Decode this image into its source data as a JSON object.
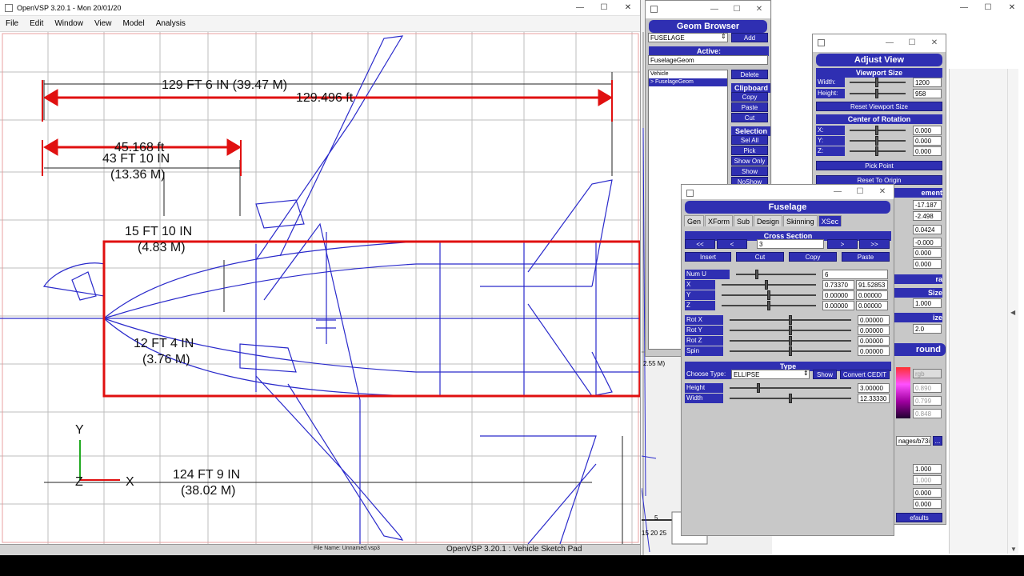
{
  "main_window": {
    "title": "OpenVSP 3.20.1 - Mon 20/01/20",
    "menu": [
      "File",
      "Edit",
      "Window",
      "View",
      "Model",
      "Analysis"
    ],
    "status_file": "File Name: Unnamed.vsp3",
    "status_title": "OpenVSP 3.20.1 : Vehicle Sketch Pad"
  },
  "drawing": {
    "dim_overall": "129 FT 6 IN (39.47 M)",
    "meas_overall": "129.496 ft",
    "meas_fwd": "45.168 ft",
    "dim_fwd_1": "43 FT 10 IN",
    "dim_fwd_2": "(13.36 M)",
    "dim_height_1": "15 FT 10 IN",
    "dim_height_2": "(4.83 M)",
    "dim_width_1": "12 FT 4 IN",
    "dim_width_2": "(3.76 M)",
    "dim_wing_1": "124 FT 9 IN",
    "dim_wing_2": "(38.02 M)",
    "axis_y": "Y",
    "axis_z": "Z",
    "axis_x": "X",
    "side_note": "2.55 M)",
    "ruler_1": "5",
    "ruler_2": "15  20  25"
  },
  "geom_browser": {
    "title": "Geom Browser",
    "type_select": "FUSELAGE",
    "add": "Add",
    "active_label": "Active:",
    "active_value": "FuselageGeom",
    "tree": [
      "Vehicle",
      "> FuselageGeom"
    ],
    "delete": "Delete",
    "clipboard": "Clipboard",
    "copy": "Copy",
    "paste": "Paste",
    "cut": "Cut",
    "selection": "Selection",
    "sel_all": "Sel All",
    "pick": "Pick",
    "show_only": "Show Only",
    "show": "Show",
    "noshow": "NoShow"
  },
  "adjust_view": {
    "title": "Adjust View",
    "viewport_size": "Viewport Size",
    "width_label": "Width:",
    "width_value": "1200",
    "height_label": "Height:",
    "height_value": "958",
    "reset_viewport": "Reset Viewport Size",
    "center_rotation": "Center of Rotation",
    "x_label": "X:",
    "y_label": "Y:",
    "z_label": "Z:",
    "x_value": "0.000",
    "y_value": "0.000",
    "z_value": "0.000",
    "pick_point": "Pick Point",
    "reset_origin": "Reset To Origin",
    "placement_frag": "ement",
    "v1": "-17.187",
    "v2": "-2.498",
    "v3": "0.0424",
    "v4": "-0.000",
    "v5": "0.000",
    "v6": "0.000",
    "ra_frag": "ra",
    "size_frag": "Size",
    "size_value": "1.000",
    "ize_frag": "ize",
    "ize_value": "2.0",
    "round_frag": "round",
    "rgb_label": "rgb",
    "c1": "0.890",
    "c2": "0.799",
    "c3": "0.848",
    "image_path": "nages/b73i",
    "browse": "...",
    "s1": "1.000",
    "s2": "1.000",
    "s3": "0.000",
    "s4": "0.000",
    "defaults": "efaults"
  },
  "fuselage": {
    "title": "Fuselage",
    "tabs": [
      "Gen",
      "XForm",
      "Sub",
      "Design",
      "Skinning",
      "XSec"
    ],
    "active_tab": "XSec",
    "cross_section": "Cross Section",
    "first": "<<",
    "prev": "<",
    "index": "3",
    "next": ">",
    "last": ">>",
    "insert": "Insert",
    "cut": "Cut",
    "copy": "Copy",
    "paste": "Paste",
    "num_u_label": "Num U",
    "num_u_value": "6",
    "x_label": "X",
    "x_value": "0.73370",
    "x_value2": "91.52853",
    "y_label": "Y",
    "y_value": "0.00000",
    "y_value2": "0.00000",
    "z_label": "Z",
    "z_value": "0.00000",
    "z_value2": "0.00000",
    "rotx_label": "Rot X",
    "rotx_value": "0.00000",
    "roty_label": "Rot Y",
    "roty_value": "0.00000",
    "rotz_label": "Rot Z",
    "rotz_value": "0.00000",
    "spin_label": "Spin",
    "spin_value": "0.00000",
    "type_head": "Type",
    "choose_type": "Choose Type:",
    "type_value": "ELLIPSE",
    "show": "Show",
    "convert": "Convert CEDIT",
    "height_label": "Height",
    "height_value": "3.00000",
    "width_label": "Width",
    "width_value": "12.33330"
  }
}
